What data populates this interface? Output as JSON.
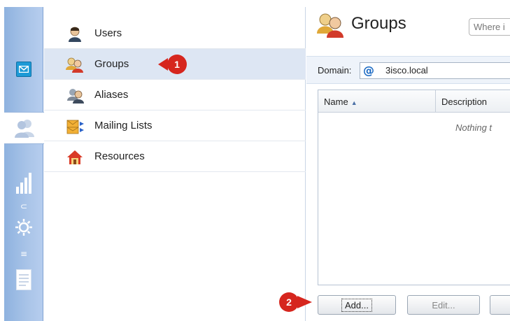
{
  "nav": {
    "items": [
      {
        "label": "Users",
        "icon": "user-icon"
      },
      {
        "label": "Groups",
        "icon": "groups-icon"
      },
      {
        "label": "Aliases",
        "icon": "aliases-icon"
      },
      {
        "label": "Mailing Lists",
        "icon": "mailing-lists-icon"
      },
      {
        "label": "Resources",
        "icon": "resources-icon"
      }
    ],
    "selected": "Groups"
  },
  "callouts": [
    "1",
    "2"
  ],
  "main": {
    "title": "Groups",
    "search_placeholder": "Where i",
    "domain_label": "Domain:",
    "domain_value": "3isco.local",
    "columns": [
      "Name",
      "Description"
    ],
    "empty_text": "Nothing t",
    "buttons": {
      "add": "Add...",
      "edit": "Edit..."
    }
  },
  "colors": {
    "accent": "#1d9ad6",
    "rail": "#a9c4e8",
    "selected_row": "#dde6f3",
    "callout": "#d6261e"
  }
}
